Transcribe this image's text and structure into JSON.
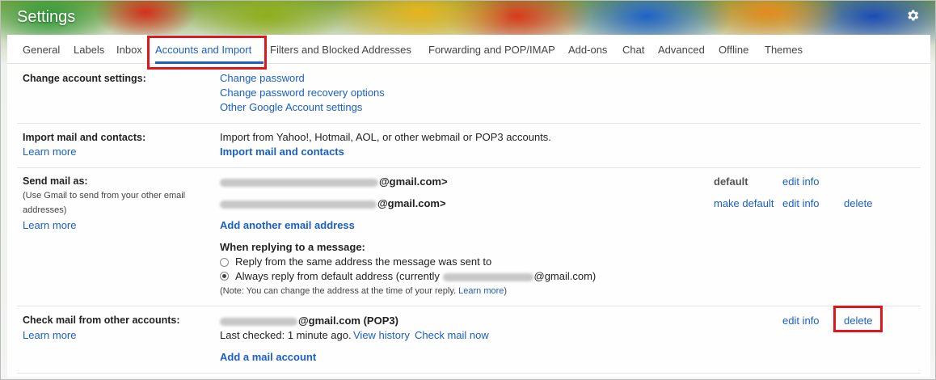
{
  "header": {
    "title": "Settings",
    "settings_icon": "gear-icon"
  },
  "tabs": [
    {
      "label": "General"
    },
    {
      "label": "Labels"
    },
    {
      "label": "Inbox"
    },
    {
      "label": "Accounts and Import",
      "active": true
    },
    {
      "label": "Filters and Blocked Addresses"
    },
    {
      "label": "Forwarding and POP/IMAP"
    },
    {
      "label": "Add-ons"
    },
    {
      "label": "Chat"
    },
    {
      "label": "Advanced"
    },
    {
      "label": "Offline"
    },
    {
      "label": "Themes"
    }
  ],
  "change_account": {
    "label": "Change account settings:",
    "links": [
      "Change password",
      "Change password recovery options",
      "Other Google Account settings"
    ]
  },
  "import_mail": {
    "label": "Import mail and contacts:",
    "learn_more": "Learn more",
    "description": "Import from Yahoo!, Hotmail, AOL, or other webmail or POP3 accounts.",
    "action": "Import mail and contacts"
  },
  "send_mail": {
    "label": "Send mail as:",
    "note_line1": "(Use Gmail to send from your other email",
    "note_line2": "addresses)",
    "learn_more": "Learn more",
    "addresses": [
      {
        "suffix": "@gmail.com>",
        "status": "default",
        "edit": "edit info"
      },
      {
        "suffix": "@gmail.com>",
        "make_default": "make default",
        "edit": "edit info",
        "delete": "delete"
      }
    ],
    "add_address": "Add another email address",
    "reply_heading": "When replying to a message:",
    "reply_option1": "Reply from the same address the message was sent to",
    "reply_option2_prefix": "Always reply from default address (currently",
    "reply_option2_suffix": "@gmail.com)",
    "reply_selected": 2,
    "reply_note": "(Note: You can change the address at the time of your reply.",
    "reply_note_link": "Learn more",
    "reply_note_end": ")"
  },
  "check_mail": {
    "label": "Check mail from other accounts:",
    "learn_more": "Learn more",
    "account_suffix": "@gmail.com (POP3)",
    "last_checked": "Last checked: 1 minute ago.",
    "view_history": "View history",
    "check_now": "Check mail now",
    "edit": "edit info",
    "delete": "delete",
    "add_account": "Add a mail account"
  },
  "colors": {
    "link": "#1a5fc8",
    "highlight": "#e1161d"
  }
}
